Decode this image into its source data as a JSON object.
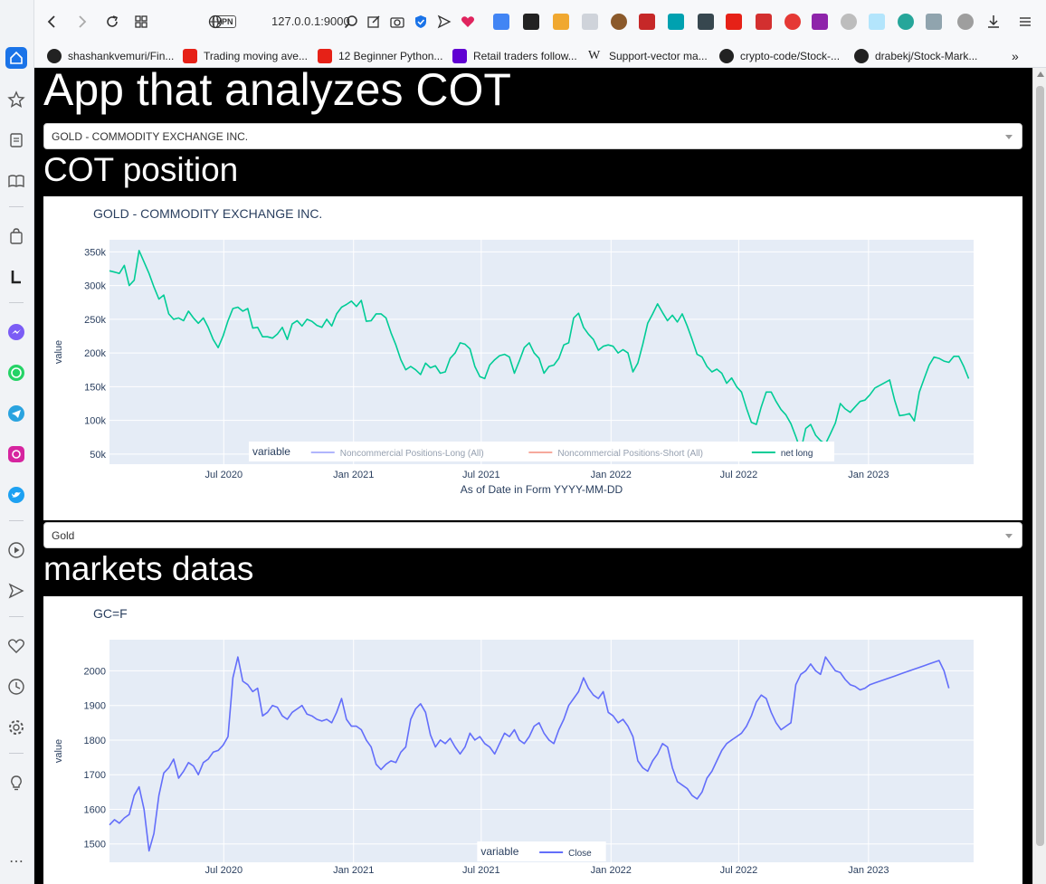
{
  "browser": {
    "address": "127.0.0.1:9000",
    "vpn_label": "VPN",
    "bookmarks": [
      {
        "label": "shashankvemuri/Fin...",
        "icon": "github-icon",
        "color": "#222222"
      },
      {
        "label": "Trading moving ave...",
        "icon": "youtube-icon",
        "color": "#e62117"
      },
      {
        "label": "12 Beginner Python...",
        "icon": "youtube-icon",
        "color": "#e62117"
      },
      {
        "label": "Retail traders follow...",
        "icon": "yahoo-icon",
        "color": "#6001d2"
      },
      {
        "label": "Support-vector ma...",
        "icon": "wikipedia-icon",
        "color": "#333333"
      },
      {
        "label": "crypto-code/Stock-...",
        "icon": "github-icon",
        "color": "#222222"
      },
      {
        "label": "drabekj/Stock-Mark...",
        "icon": "github-icon",
        "color": "#222222"
      }
    ],
    "more_label": "»"
  },
  "page": {
    "title": "App that analyzes COT",
    "cot_dropdown_value": "GOLD - COMMODITY EXCHANGE INC.",
    "cot_section_title": "COT position",
    "market_dropdown_value": "Gold",
    "market_section_title": "markets datas"
  },
  "colors": {
    "plot_bg": "#e5ecf6",
    "net_long": "#00cc96",
    "long": "#636efa",
    "short": "#ef553b",
    "close": "#636efa"
  },
  "chart_data": [
    {
      "type": "line",
      "title": "GOLD - COMMODITY EXCHANGE INC.",
      "xlabel": "As of Date in Form YYYY-MM-DD",
      "ylabel": "value",
      "x_range": [
        "2020-01-21",
        "2023-05-30"
      ],
      "ylim": [
        35000,
        368000
      ],
      "x_ticks": [
        "Jul 2020",
        "Jan 2021",
        "Jul 2021",
        "Jan 2022",
        "Jul 2022",
        "Jan 2023"
      ],
      "y_ticks": [
        {
          "value": 50000,
          "label": "50k"
        },
        {
          "value": 100000,
          "label": "100k"
        },
        {
          "value": 150000,
          "label": "150k"
        },
        {
          "value": 200000,
          "label": "200k"
        },
        {
          "value": 250000,
          "label": "250k"
        },
        {
          "value": 300000,
          "label": "300k"
        },
        {
          "value": 350000,
          "label": "350k"
        }
      ],
      "legend_title": "variable",
      "legend_position": "bottom-center",
      "legend": [
        {
          "name": "Noncommercial Positions-Long (All)",
          "color": "#636efa",
          "hidden": true
        },
        {
          "name": "Noncommercial Positions-Short (All)",
          "color": "#ef553b",
          "hidden": true
        },
        {
          "name": "net long",
          "color": "#00cc96",
          "hidden": false
        }
      ],
      "series": [
        {
          "name": "net long",
          "start_date": "2020-01-21",
          "step_days": 7,
          "values": [
            322000,
            320000,
            318000,
            330000,
            300000,
            308000,
            352000,
            335000,
            318000,
            298000,
            280000,
            286000,
            258000,
            250000,
            252000,
            248000,
            262000,
            252000,
            244000,
            252000,
            238000,
            220000,
            208000,
            225000,
            248000,
            266000,
            268000,
            262000,
            266000,
            237000,
            238000,
            224000,
            224000,
            222000,
            228000,
            238000,
            220000,
            243000,
            248000,
            240000,
            250000,
            247000,
            241000,
            238000,
            250000,
            240000,
            258000,
            268000,
            272000,
            277000,
            269000,
            278000,
            247000,
            248000,
            258000,
            258000,
            252000,
            230000,
            212000,
            190000,
            175000,
            180000,
            175000,
            168000,
            185000,
            178000,
            181000,
            170000,
            172000,
            192000,
            200000,
            215000,
            213000,
            206000,
            180000,
            165000,
            162000,
            182000,
            190000,
            196000,
            198000,
            194000,
            170000,
            188000,
            208000,
            215000,
            200000,
            192000,
            170000,
            180000,
            182000,
            192000,
            212000,
            215000,
            252000,
            259000,
            238000,
            228000,
            220000,
            204000,
            210000,
            212000,
            210000,
            200000,
            205000,
            200000,
            172000,
            185000,
            213000,
            244000,
            258000,
            273000,
            260000,
            248000,
            256000,
            246000,
            258000,
            240000,
            220000,
            198000,
            194000,
            180000,
            172000,
            176000,
            170000,
            155000,
            163000,
            150000,
            142000,
            118000,
            97000,
            94000,
            120000,
            142000,
            142000,
            128000,
            116000,
            108000,
            95000,
            76000,
            55000,
            88000,
            94000,
            78000,
            70000,
            65000,
            80000,
            96000,
            125000,
            117000,
            112000,
            120000,
            128000,
            130000,
            138000,
            148000,
            152000,
            156000,
            160000,
            130000,
            107000,
            108000,
            110000,
            99000,
            142000,
            162000,
            182000,
            194000,
            192000,
            188000,
            186000,
            195000,
            195000,
            180000,
            162000
          ]
        }
      ]
    },
    {
      "type": "line",
      "title": "GC=F",
      "xlabel": "",
      "ylabel": "value",
      "x_range": [
        "2020-01-21",
        "2023-05-30"
      ],
      "ylim": [
        1447,
        2090
      ],
      "x_ticks": [
        "Jul 2020",
        "Jan 2021",
        "Jul 2021",
        "Jan 2022",
        "Jul 2022",
        "Jan 2023"
      ],
      "y_ticks": [
        {
          "value": 1500,
          "label": "1500"
        },
        {
          "value": 1600,
          "label": "1600"
        },
        {
          "value": 1700,
          "label": "1700"
        },
        {
          "value": 1800,
          "label": "1800"
        },
        {
          "value": 1900,
          "label": "1900"
        },
        {
          "value": 2000,
          "label": "2000"
        }
      ],
      "legend_title": "variable",
      "legend_position": "bottom-center",
      "legend": [
        {
          "name": "Close",
          "color": "#636efa",
          "hidden": false
        }
      ],
      "series": [
        {
          "name": "Close",
          "start_date": "2020-01-21",
          "step_days": 7,
          "values": [
            1555,
            1570,
            1560,
            1575,
            1585,
            1640,
            1665,
            1600,
            1480,
            1530,
            1640,
            1705,
            1720,
            1745,
            1690,
            1710,
            1735,
            1725,
            1700,
            1735,
            1745,
            1765,
            1770,
            1785,
            1810,
            1980,
            2040,
            1970,
            1960,
            1940,
            1950,
            1870,
            1880,
            1900,
            1895,
            1870,
            1860,
            1880,
            1890,
            1900,
            1875,
            1870,
            1860,
            1855,
            1860,
            1850,
            1880,
            1920,
            1860,
            1840,
            1840,
            1830,
            1800,
            1780,
            1730,
            1715,
            1730,
            1740,
            1735,
            1765,
            1780,
            1860,
            1890,
            1905,
            1880,
            1815,
            1780,
            1800,
            1790,
            1805,
            1780,
            1760,
            1780,
            1820,
            1800,
            1810,
            1790,
            1780,
            1760,
            1790,
            1820,
            1810,
            1830,
            1800,
            1790,
            1810,
            1840,
            1850,
            1820,
            1800,
            1790,
            1830,
            1860,
            1900,
            1920,
            1940,
            1980,
            1950,
            1930,
            1920,
            1940,
            1880,
            1870,
            1850,
            1860,
            1840,
            1810,
            1740,
            1720,
            1710,
            1740,
            1760,
            1790,
            1780,
            1720,
            1680,
            1670,
            1660,
            1640,
            1630,
            1650,
            1690,
            1710,
            1740,
            1770,
            1790,
            1800,
            1810,
            1820,
            1840,
            1870,
            1910,
            1930,
            1920,
            1880,
            1850,
            1830,
            1840,
            1850,
            1960,
            1990,
            2000,
            2020,
            2000,
            1990,
            2040,
            2020,
            2000,
            1995,
            1975,
            1960,
            1955,
            1945,
            1950,
            1960,
            1965,
            1970,
            1975,
            1980,
            1985,
            1990,
            1995,
            2000,
            2005,
            2010,
            2015,
            2020,
            2025,
            2030,
            2000,
            1950
          ]
        }
      ]
    }
  ]
}
